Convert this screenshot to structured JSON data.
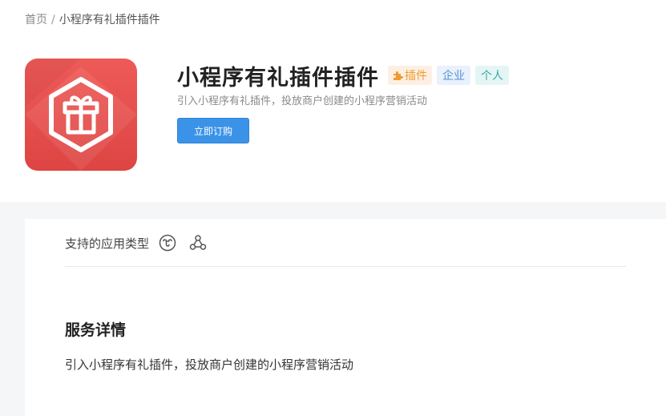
{
  "breadcrumb": {
    "home": "首页",
    "separator": "/",
    "current": "小程序有礼插件插件"
  },
  "product": {
    "title": "小程序有礼插件插件",
    "icon": "gift-icon",
    "icon_color": "#e84e4c",
    "tags": {
      "plugin": "插件",
      "enterprise": "企业",
      "personal": "个人"
    },
    "subtitle": "引入小程序有礼插件，投放商户创建的小程序营销活动",
    "buy_button": "立即订购"
  },
  "app_types": {
    "label": "支持的应用类型",
    "icons": [
      "wechat-mini-program-icon",
      "nodes-icon"
    ]
  },
  "service": {
    "title": "服务详情",
    "description": "引入小程序有礼插件，投放商户创建的小程序营销活动"
  },
  "colors": {
    "accent": "#3b93e8",
    "plugin_tag": "#f09a33",
    "enterprise_tag": "#5a8fd6",
    "personal_tag": "#3aa7a5"
  }
}
